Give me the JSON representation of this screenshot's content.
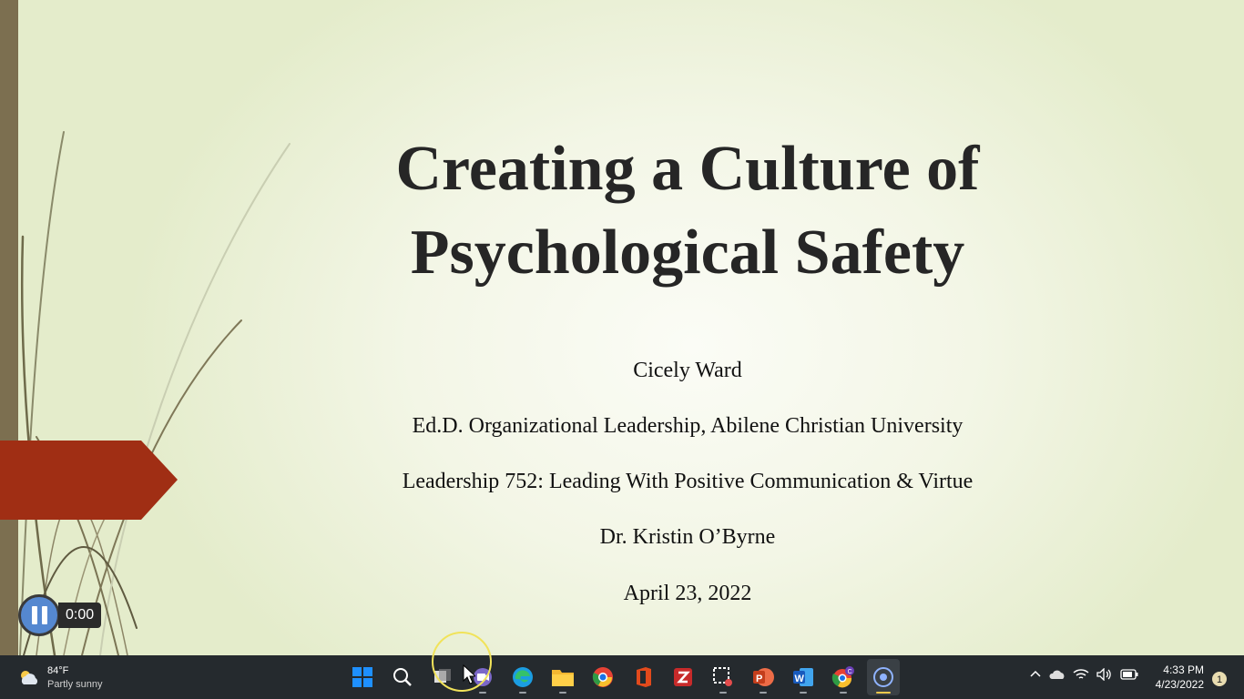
{
  "slide": {
    "title_lines": [
      "Creating a Culture of",
      "Psychological Safety"
    ],
    "presenter": "Cicely Ward",
    "program": "Ed.D. Organizational Leadership, Abilene Christian University",
    "course": "Leadership 752: Leading With Positive Communication & Virtue",
    "instructor": "Dr. Kristin O’Byrne",
    "date": "April 23, 2022",
    "accent_color": "#a02e14"
  },
  "media": {
    "time": "0:00",
    "state": "pause-icon"
  },
  "taskbar": {
    "weather": {
      "temp": "84°F",
      "condition": "Partly sunny",
      "icon": "partly-sunny-icon"
    },
    "apps": [
      "windows-start-icon",
      "search-icon",
      "task-view-icon",
      "teams-chat-icon",
      "edge-icon",
      "file-explorer-icon",
      "chrome-icon",
      "office-icon",
      "zotero-icon",
      "snipping-tool-icon",
      "powerpoint-icon",
      "word-icon",
      "chrome-profile-icon",
      "screen-recorder-icon"
    ],
    "tray": [
      "chevron-up-icon",
      "onedrive-icon",
      "wifi-icon",
      "volume-icon",
      "battery-icon"
    ],
    "clock": {
      "time": "4:33 PM",
      "date": "4/23/2022"
    },
    "notifications": "1"
  }
}
